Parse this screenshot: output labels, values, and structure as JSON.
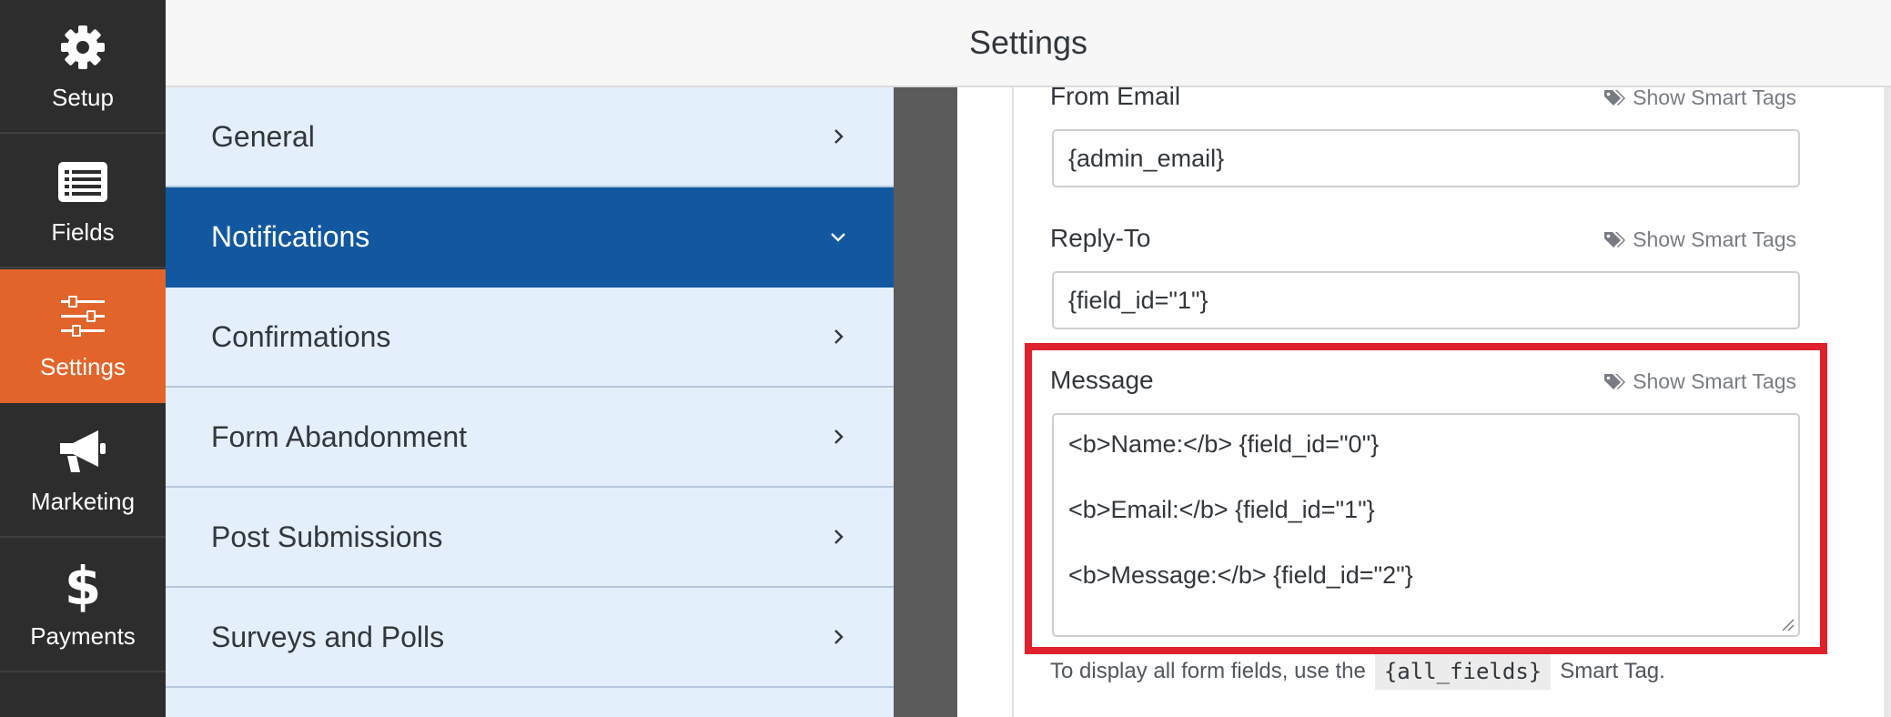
{
  "header": {
    "title": "Settings"
  },
  "leftnav": {
    "items": [
      {
        "label": "Setup",
        "icon": "gear-icon",
        "active": false
      },
      {
        "label": "Fields",
        "icon": "list-icon",
        "active": false
      },
      {
        "label": "Settings",
        "icon": "sliders-icon",
        "active": true
      },
      {
        "label": "Marketing",
        "icon": "megaphone-icon",
        "active": false
      },
      {
        "label": "Payments",
        "icon": "dollar-icon",
        "active": false
      }
    ]
  },
  "sections": {
    "items": [
      {
        "label": "General",
        "expanded": false
      },
      {
        "label": "Notifications",
        "expanded": true
      },
      {
        "label": "Confirmations",
        "expanded": false
      },
      {
        "label": "Form Abandonment",
        "expanded": false
      },
      {
        "label": "Post Submissions",
        "expanded": false
      },
      {
        "label": "Surveys and Polls",
        "expanded": false
      }
    ]
  },
  "form": {
    "smart_tags_label": "Show Smart Tags",
    "from_email": {
      "label": "From Email",
      "value": "{admin_email}"
    },
    "reply_to": {
      "label": "Reply-To",
      "value": "{field_id=\"1\"}"
    },
    "message": {
      "label": "Message",
      "lines": [
        "<b>Name:</b> {field_id=\"0\"}",
        "<b>Email:</b> {field_id=\"1\"}",
        "<b>Message:</b> {field_id=\"2\"}"
      ]
    },
    "helper": {
      "prefix": "To display all form fields, use the",
      "code": "{all_fields}",
      "suffix": "Smart Tag."
    }
  },
  "colors": {
    "nav_bg": "#2d2d2d",
    "nav_active": "#e2642a",
    "section_bg": "#e3effb",
    "section_active": "#1258a0",
    "highlight": "#e0202a"
  }
}
